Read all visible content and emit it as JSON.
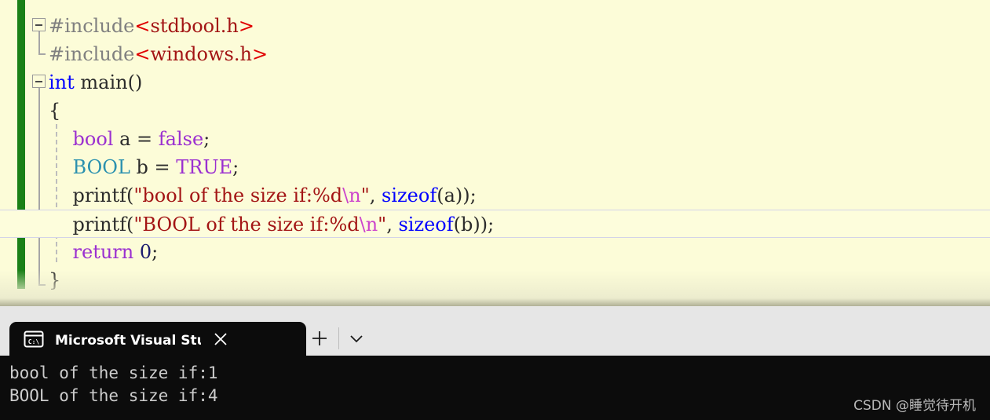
{
  "editor": {
    "name": "visual-studio-code-editor",
    "background_color": "#fcfcd8",
    "change_bar_color": "#1a8017",
    "current_line_index": 7,
    "lines": [
      {
        "n": 1,
        "indent": 0,
        "fold": "open",
        "tokens": [
          {
            "t": "#include",
            "c": "c-pre"
          },
          {
            "t": "<",
            "c": "c-ang"
          },
          {
            "t": "stdbool.h",
            "c": "c-str"
          },
          {
            "t": ">",
            "c": "c-ang"
          }
        ]
      },
      {
        "n": 2,
        "indent": 0,
        "fold": "none",
        "tokens": [
          {
            "t": "#include",
            "c": "c-pre"
          },
          {
            "t": "<",
            "c": "c-ang"
          },
          {
            "t": "windows.h",
            "c": "c-str"
          },
          {
            "t": ">",
            "c": "c-ang"
          }
        ]
      },
      {
        "n": 3,
        "indent": 0,
        "fold": "open",
        "tokens": [
          {
            "t": "int",
            "c": "c-kw"
          },
          {
            "t": " ",
            "c": "c-plain"
          },
          {
            "t": "main",
            "c": "c-fn"
          },
          {
            "t": "()",
            "c": "c-punct"
          }
        ]
      },
      {
        "n": 4,
        "indent": 0,
        "fold": "none",
        "tokens": [
          {
            "t": "{",
            "c": "c-punct"
          }
        ]
      },
      {
        "n": 5,
        "indent": 1,
        "fold": "none",
        "tokens": [
          {
            "t": "    ",
            "c": "c-plain"
          },
          {
            "t": "bool",
            "c": "c-kw2"
          },
          {
            "t": " a ",
            "c": "c-plain"
          },
          {
            "t": "=",
            "c": "c-punct"
          },
          {
            "t": " ",
            "c": "c-plain"
          },
          {
            "t": "false",
            "c": "c-kw2"
          },
          {
            "t": ";",
            "c": "c-punct"
          }
        ]
      },
      {
        "n": 6,
        "indent": 1,
        "fold": "none",
        "tokens": [
          {
            "t": "    ",
            "c": "c-plain"
          },
          {
            "t": "BOOL",
            "c": "c-type"
          },
          {
            "t": " b ",
            "c": "c-plain"
          },
          {
            "t": "=",
            "c": "c-punct"
          },
          {
            "t": " ",
            "c": "c-plain"
          },
          {
            "t": "TRUE",
            "c": "c-kw2"
          },
          {
            "t": ";",
            "c": "c-punct"
          }
        ]
      },
      {
        "n": 7,
        "indent": 1,
        "fold": "none",
        "tokens": [
          {
            "t": "    ",
            "c": "c-plain"
          },
          {
            "t": "printf",
            "c": "c-fn"
          },
          {
            "t": "(",
            "c": "c-punct"
          },
          {
            "t": "\"bool of the size if:%d",
            "c": "c-str"
          },
          {
            "t": "\\n",
            "c": "c-esc"
          },
          {
            "t": "\"",
            "c": "c-str"
          },
          {
            "t": ", ",
            "c": "c-punct"
          },
          {
            "t": "sizeof",
            "c": "c-kw"
          },
          {
            "t": "(a));",
            "c": "c-punct"
          }
        ]
      },
      {
        "n": 8,
        "indent": 1,
        "fold": "none",
        "tokens": [
          {
            "t": "    ",
            "c": "c-plain"
          },
          {
            "t": "printf",
            "c": "c-fn"
          },
          {
            "t": "(",
            "c": "c-punct"
          },
          {
            "t": "\"BOOL of the size if:%d",
            "c": "c-str"
          },
          {
            "t": "\\n",
            "c": "c-esc"
          },
          {
            "t": "\"",
            "c": "c-str"
          },
          {
            "t": ", ",
            "c": "c-punct"
          },
          {
            "t": "sizeof",
            "c": "c-kw"
          },
          {
            "t": "(b));",
            "c": "c-punct"
          }
        ]
      },
      {
        "n": 9,
        "indent": 1,
        "fold": "none",
        "tokens": [
          {
            "t": "    ",
            "c": "c-plain"
          },
          {
            "t": "return",
            "c": "c-kw2"
          },
          {
            "t": " ",
            "c": "c-plain"
          },
          {
            "t": "0",
            "c": "c-num"
          },
          {
            "t": ";",
            "c": "c-punct"
          }
        ]
      },
      {
        "n": 10,
        "indent": 0,
        "fold": "none",
        "tokens": [
          {
            "t": "}",
            "c": "c-punct"
          }
        ]
      }
    ]
  },
  "terminal": {
    "name": "windows-terminal",
    "background_color": "#0c0c0c",
    "tabbar_color": "#e6e6e6",
    "tab": {
      "icon": "command-prompt-icon",
      "icon_label": "C:\\",
      "title": "Microsoft Visual Studio 调试控制台",
      "close_label": "✕"
    },
    "new_tab_label": "+",
    "tab_menu_label": "⌄",
    "console_lines": [
      "bool of the size if:1",
      "BOOL of the size if:4"
    ],
    "watermark": "CSDN @睡觉待开机"
  }
}
